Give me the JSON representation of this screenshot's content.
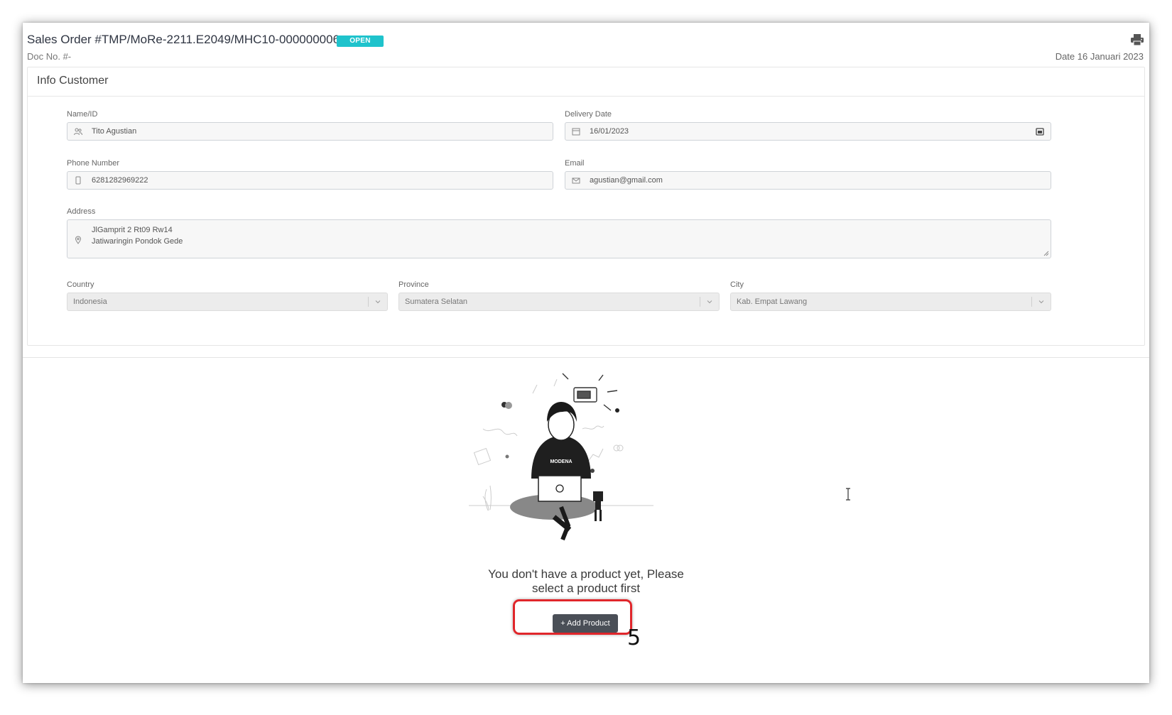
{
  "header": {
    "order_title": "Sales Order #TMP/MoRe-2211.E2049/MHC10-000000006",
    "status": "OPEN",
    "doc_no": "Doc No. #-",
    "date": "Date 16 Januari 2023"
  },
  "info_customer": {
    "title": "Info Customer",
    "name": {
      "label": "Name/ID",
      "value": "Tito Agustian",
      "icon": "user-icon"
    },
    "delivery_date": {
      "label": "Delivery Date",
      "value": "16/01/2023",
      "icon": "calendar-icon"
    },
    "phone": {
      "label": "Phone Number",
      "value": "6281282969222",
      "icon": "phone-icon"
    },
    "email": {
      "label": "Email",
      "value": "agustian@gmail.com",
      "icon": "envelope-icon"
    },
    "address": {
      "label": "Address",
      "line1": "JlGamprit 2 Rt09 Rw14",
      "line2": "Jatiwaringin Pondok Gede",
      "icon": "map-pin-icon"
    },
    "country": {
      "label": "Country",
      "value": "Indonesia"
    },
    "province": {
      "label": "Province",
      "value": "Sumatera Selatan"
    },
    "city": {
      "label": "City",
      "value": "Kab. Empat Lawang"
    }
  },
  "empty_state": {
    "message_line1": "You don't have a product yet, Please",
    "message_line2": "select a product first",
    "add_button": "+ Add Product",
    "illustration_brand": "MODENA"
  },
  "annotation": {
    "step": "5",
    "color": "#e0262b"
  },
  "colors": {
    "status_badge": "#1fc3cc",
    "button": "#4a4f57"
  }
}
